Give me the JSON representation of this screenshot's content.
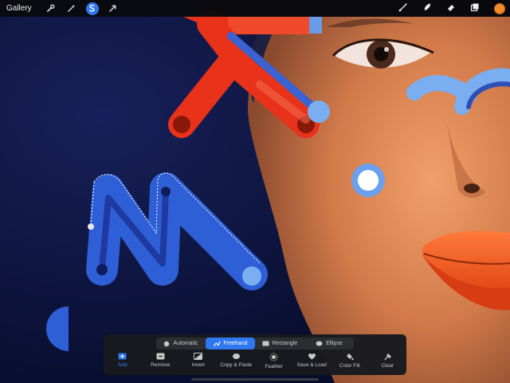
{
  "topbar": {
    "gallery_label": "Gallery",
    "left_tools": [
      {
        "name": "wrench-icon"
      },
      {
        "name": "magic-wand-icon"
      },
      {
        "name": "selection-icon",
        "active": true
      },
      {
        "name": "transform-arrow-icon"
      }
    ],
    "right_tools": [
      {
        "name": "brush-icon"
      },
      {
        "name": "smudge-icon"
      },
      {
        "name": "eraser-icon"
      },
      {
        "name": "layers-icon"
      },
      {
        "name": "color-swatch",
        "color": "#f08a2a"
      }
    ]
  },
  "selection_panel": {
    "modes": [
      {
        "label": "Automatic",
        "icon": "circle-icon",
        "active": false
      },
      {
        "label": "Freehand",
        "icon": "freehand-icon",
        "active": true
      },
      {
        "label": "Rectangle",
        "icon": "rectangle-icon",
        "active": false
      },
      {
        "label": "Ellipse",
        "icon": "ellipse-icon",
        "active": false
      }
    ],
    "actions": [
      {
        "label": "Add",
        "icon": "add-icon",
        "active": true
      },
      {
        "label": "Remove",
        "icon": "remove-icon",
        "active": false
      },
      {
        "label": "Invert",
        "icon": "invert-icon",
        "active": false
      },
      {
        "label": "Copy & Paste",
        "icon": "copy-paste-icon",
        "active": false
      },
      {
        "label": "Feather",
        "icon": "feather-icon",
        "active": false
      },
      {
        "label": "Save & Load",
        "icon": "heart-icon",
        "active": false
      },
      {
        "label": "Color Fill",
        "icon": "color-fill-icon",
        "active": false
      },
      {
        "label": "Clear",
        "icon": "clear-icon",
        "active": false
      }
    ]
  },
  "colors": {
    "accent": "#2f78f2",
    "background": "#0b1238",
    "red_shape": "#e8321a",
    "blue_shape": "#2f5fd6",
    "light_blue": "#7aaef0"
  }
}
